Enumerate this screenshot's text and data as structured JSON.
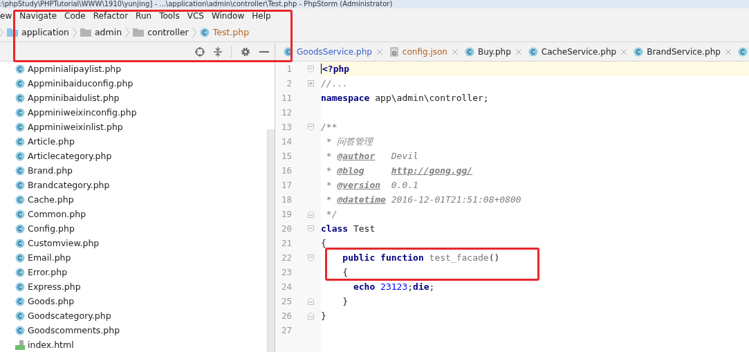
{
  "window": {
    "title": ":\\phpStudy\\PHPTutorial\\WWW\\1910\\yunjing] - ...\\application\\admin\\controller\\Test.php - PhpStorm (Administrator)"
  },
  "menu_bar": {
    "highlighted": true,
    "items": [
      "ew",
      "Navigate",
      "Code",
      "Refactor",
      "Run",
      "Tools",
      "VCS",
      "Window",
      "Help"
    ]
  },
  "breadcrumb": [
    {
      "label": "application",
      "kind": "source-folder"
    },
    {
      "label": "admin",
      "kind": "folder"
    },
    {
      "label": "controller",
      "kind": "folder"
    },
    {
      "label": "Test.php",
      "kind": "class"
    }
  ],
  "project_tree": {
    "items": [
      {
        "label": "Appminialipaylist.php",
        "kind": "class"
      },
      {
        "label": "Appminibaiduconfig.php",
        "kind": "class"
      },
      {
        "label": "Appminibaidulist.php",
        "kind": "class"
      },
      {
        "label": "Appminiweixinconfig.php",
        "kind": "class"
      },
      {
        "label": "Appminiweixinlist.php",
        "kind": "class"
      },
      {
        "label": "Article.php",
        "kind": "class"
      },
      {
        "label": "Articlecategory.php",
        "kind": "class"
      },
      {
        "label": "Brand.php",
        "kind": "class"
      },
      {
        "label": "Brandcategory.php",
        "kind": "class"
      },
      {
        "label": "Cache.php",
        "kind": "class"
      },
      {
        "label": "Common.php",
        "kind": "class"
      },
      {
        "label": "Config.php",
        "kind": "class"
      },
      {
        "label": "Customview.php",
        "kind": "class"
      },
      {
        "label": "Email.php",
        "kind": "class"
      },
      {
        "label": "Error.php",
        "kind": "class"
      },
      {
        "label": "Express.php",
        "kind": "class"
      },
      {
        "label": "Goods.php",
        "kind": "class"
      },
      {
        "label": "Goodscategory.php",
        "kind": "class"
      },
      {
        "label": "Goodscomments.php",
        "kind": "class"
      },
      {
        "label": "index.html",
        "kind": "html"
      }
    ]
  },
  "editor_tabs": [
    {
      "label": "GoodsService.php",
      "kind": "class",
      "color": "#3a5fcd"
    },
    {
      "label": "config.json",
      "kind": "json",
      "color": "#b0602a"
    },
    {
      "label": "Buy.php",
      "kind": "class",
      "color": "#222222"
    },
    {
      "label": "CacheService.php",
      "kind": "class",
      "color": "#222222"
    },
    {
      "label": "BrandService.php",
      "kind": "class",
      "color": "#222222"
    },
    {
      "kind": "class-partial"
    }
  ],
  "code": [
    {
      "number": "1",
      "kind": "fold-start",
      "current": true,
      "tokens": [
        {
          "kind": "tag",
          "text": "<?php"
        }
      ]
    },
    {
      "number": "2",
      "kind": "folded",
      "current": false,
      "tokens": [
        {
          "kind": "comment",
          "text": "//..."
        }
      ]
    },
    {
      "number": "11",
      "kind": "plain",
      "current": false,
      "tokens": [
        {
          "kind": "keyword",
          "text": "namespace"
        },
        {
          "kind": "plain",
          "text": " app\\admin\\controller;"
        }
      ]
    },
    {
      "number": "12",
      "kind": "plain",
      "current": false
    },
    {
      "number": "13",
      "kind": "fold-start",
      "current": false,
      "tokens": [
        {
          "kind": "comment",
          "text": "/**"
        }
      ]
    },
    {
      "number": "14",
      "kind": "plain",
      "current": false,
      "tokens": [
        {
          "kind": "comment",
          "text": " * 问答管理"
        }
      ]
    },
    {
      "number": "15",
      "kind": "plain",
      "current": false,
      "tokens": [
        {
          "kind": "comment",
          "text": " * "
        },
        {
          "kind": "doctag",
          "text": "@author"
        },
        {
          "kind": "comment",
          "text": "   Devil"
        }
      ]
    },
    {
      "number": "16",
      "kind": "plain",
      "current": false,
      "tokens": [
        {
          "kind": "comment",
          "text": " * "
        },
        {
          "kind": "doctag",
          "text": "@blog"
        },
        {
          "kind": "link",
          "text": "     http://gong.gg/"
        }
      ]
    },
    {
      "number": "17",
      "kind": "plain",
      "current": false,
      "tokens": [
        {
          "kind": "comment",
          "text": " * "
        },
        {
          "kind": "doctag",
          "text": "@version"
        },
        {
          "kind": "comment",
          "text": "  0.0.1"
        }
      ]
    },
    {
      "number": "18",
      "kind": "plain",
      "current": false,
      "tokens": [
        {
          "kind": "comment",
          "text": " * "
        },
        {
          "kind": "doctag",
          "text": "@datetime"
        },
        {
          "kind": "comment",
          "text": " 2016-12-01T21:51:08+0800"
        }
      ]
    },
    {
      "number": "19",
      "kind": "fold-end",
      "current": false,
      "tokens": [
        {
          "kind": "comment",
          "text": " */"
        }
      ]
    },
    {
      "number": "20",
      "kind": "fold-start",
      "current": false,
      "tokens": [
        {
          "kind": "keyword",
          "text": "class"
        },
        {
          "kind": "plain",
          "text": " Test"
        }
      ]
    },
    {
      "number": "21",
      "kind": "plain",
      "current": false,
      "tokens": [
        {
          "kind": "plain",
          "text": "{"
        }
      ]
    },
    {
      "number": "22",
      "kind": "fold-start",
      "current": false,
      "highlighted": true,
      "tokens": [
        {
          "kind": "keyword",
          "text": "    public"
        },
        {
          "kind": "keyword",
          "text": " function"
        },
        {
          "kind": "function",
          "text": " test_facade"
        },
        {
          "kind": "plain",
          "text": "()"
        }
      ]
    },
    {
      "number": "23",
      "kind": "plain",
      "current": false,
      "highlighted": true,
      "tokens": [
        {
          "kind": "plain",
          "text": "    {"
        }
      ]
    },
    {
      "number": "24",
      "kind": "plain",
      "current": false,
      "tokens": [
        {
          "kind": "keyword",
          "text": "      echo"
        },
        {
          "kind": "number",
          "text": " 23123"
        },
        {
          "kind": "plain",
          "text": ";"
        },
        {
          "kind": "keyword",
          "text": "die"
        },
        {
          "kind": "plain",
          "text": ";"
        }
      ]
    },
    {
      "number": "25",
      "kind": "fold-end",
      "current": false,
      "tokens": [
        {
          "kind": "plain",
          "text": "    }"
        }
      ]
    },
    {
      "number": "26",
      "kind": "fold-end",
      "current": false,
      "tokens": [
        {
          "kind": "plain",
          "text": "}"
        }
      ]
    },
    {
      "number": "27",
      "kind": "plain",
      "current": false
    }
  ]
}
